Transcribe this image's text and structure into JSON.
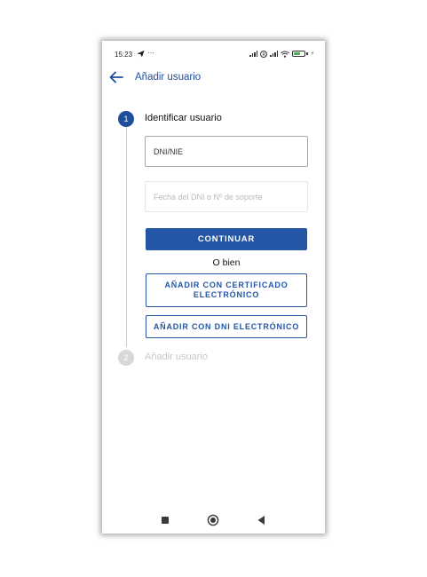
{
  "status_bar": {
    "time": "15:23",
    "notification_icons": [
      "send-icon",
      "more-dots-icon"
    ],
    "more_dots": "···",
    "system_icons": [
      "signal-icon",
      "r-icon",
      "signal-icon",
      "wifi-icon",
      "battery-icon",
      "charging-icon"
    ],
    "battery_label": "4",
    "roaming_label": "R"
  },
  "app_bar": {
    "back_icon": "arrow-left-icon",
    "title": "Añadir usuario"
  },
  "stepper": {
    "steps": [
      {
        "number": "1",
        "label": "Identificar usuario",
        "active": true
      },
      {
        "number": "2",
        "label": "Añadir usuario",
        "active": false
      }
    ]
  },
  "form": {
    "dni_placeholder": "DNI/NIE",
    "dni_value": "",
    "fecha_placeholder": "Fecha del DNI o Nº de soporte",
    "fecha_value": ""
  },
  "actions": {
    "continue_label": "CONTINUAR",
    "separator_text": "O bien",
    "certificate_label": "AÑADIR CON CERTIFICADO ELECTRÓNICO",
    "dnie_label": "AÑADIR CON DNI ELECTRÓNICO"
  },
  "nav_bar": {
    "icons": [
      "recent-apps-icon",
      "home-icon",
      "back-icon"
    ]
  },
  "colors": {
    "primary": "#2456a6",
    "title": "#1f4e9c",
    "inactive_step": "#d8d8d8",
    "battery_fill": "#3cb44a"
  }
}
